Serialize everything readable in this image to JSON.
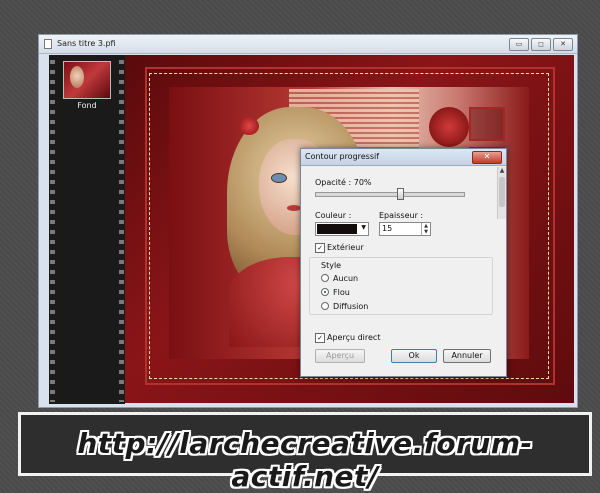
{
  "window": {
    "title": "Sans titre 3.pfi",
    "minimize": "▭",
    "restore": "◻",
    "close": "✕"
  },
  "layers": [
    {
      "label": "Fond"
    }
  ],
  "dialog": {
    "title": "Contour progressif",
    "close": "✕",
    "opacity_label": "Opacité : 70%",
    "opacity_value": 70,
    "color_label": "Couleur :",
    "color_value": "#120c0c",
    "thickness_label": "Epaisseur :",
    "thickness_value": "15",
    "exterior_label": "Extérieur",
    "exterior_checked": true,
    "style_label": "Style",
    "styles": [
      {
        "label": "Aucun",
        "selected": false
      },
      {
        "label": "Flou",
        "selected": true
      },
      {
        "label": "Diffusion",
        "selected": false
      }
    ],
    "preview_direct_label": "Aperçu direct",
    "preview_direct_checked": true,
    "preview_button": "Aperçu",
    "ok_button": "Ok",
    "cancel_button": "Annuler"
  },
  "banner": {
    "url": "http://larchecreative.forum-actif.net/"
  },
  "colors": {
    "accent_red": "#8a1518",
    "dialog_bg": "#f0f0f0",
    "window_chrome": "#d9e2ec"
  }
}
